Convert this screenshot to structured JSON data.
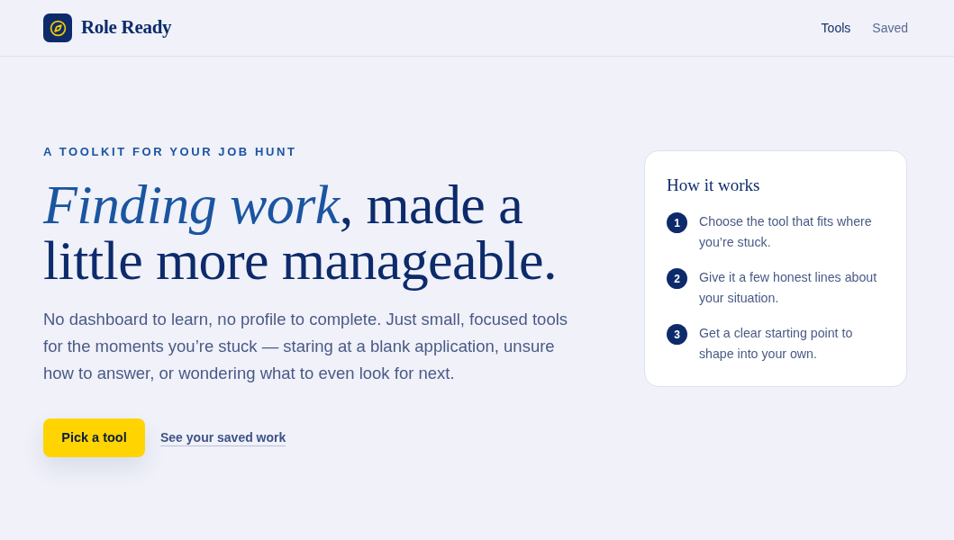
{
  "header": {
    "brand": "Role Ready",
    "nav": [
      {
        "label": "Tools",
        "selected": true
      },
      {
        "label": "Saved",
        "selected": false
      }
    ]
  },
  "hero": {
    "eyebrow": "A TOOLKIT FOR YOUR JOB HUNT",
    "headline": "*Finding work*, made a little more manageable.",
    "body": "No dashboard to learn, no profile to complete. Just small, focused tools for the moments you’re stuck — staring at a blank application, unsure how to answer, or wondering what to even look for next.",
    "primary_button": "Pick a tool",
    "secondary_link": "See your saved work"
  },
  "how_it_works": {
    "title": "How it works",
    "steps": [
      {
        "number": "1",
        "text": "Choose the tool that fits where you’re stuck."
      },
      {
        "number": "2",
        "text": "Give it a few honest lines about your situation."
      },
      {
        "number": "3",
        "text": "Get a clear starting point to shape into your own."
      }
    ]
  }
}
